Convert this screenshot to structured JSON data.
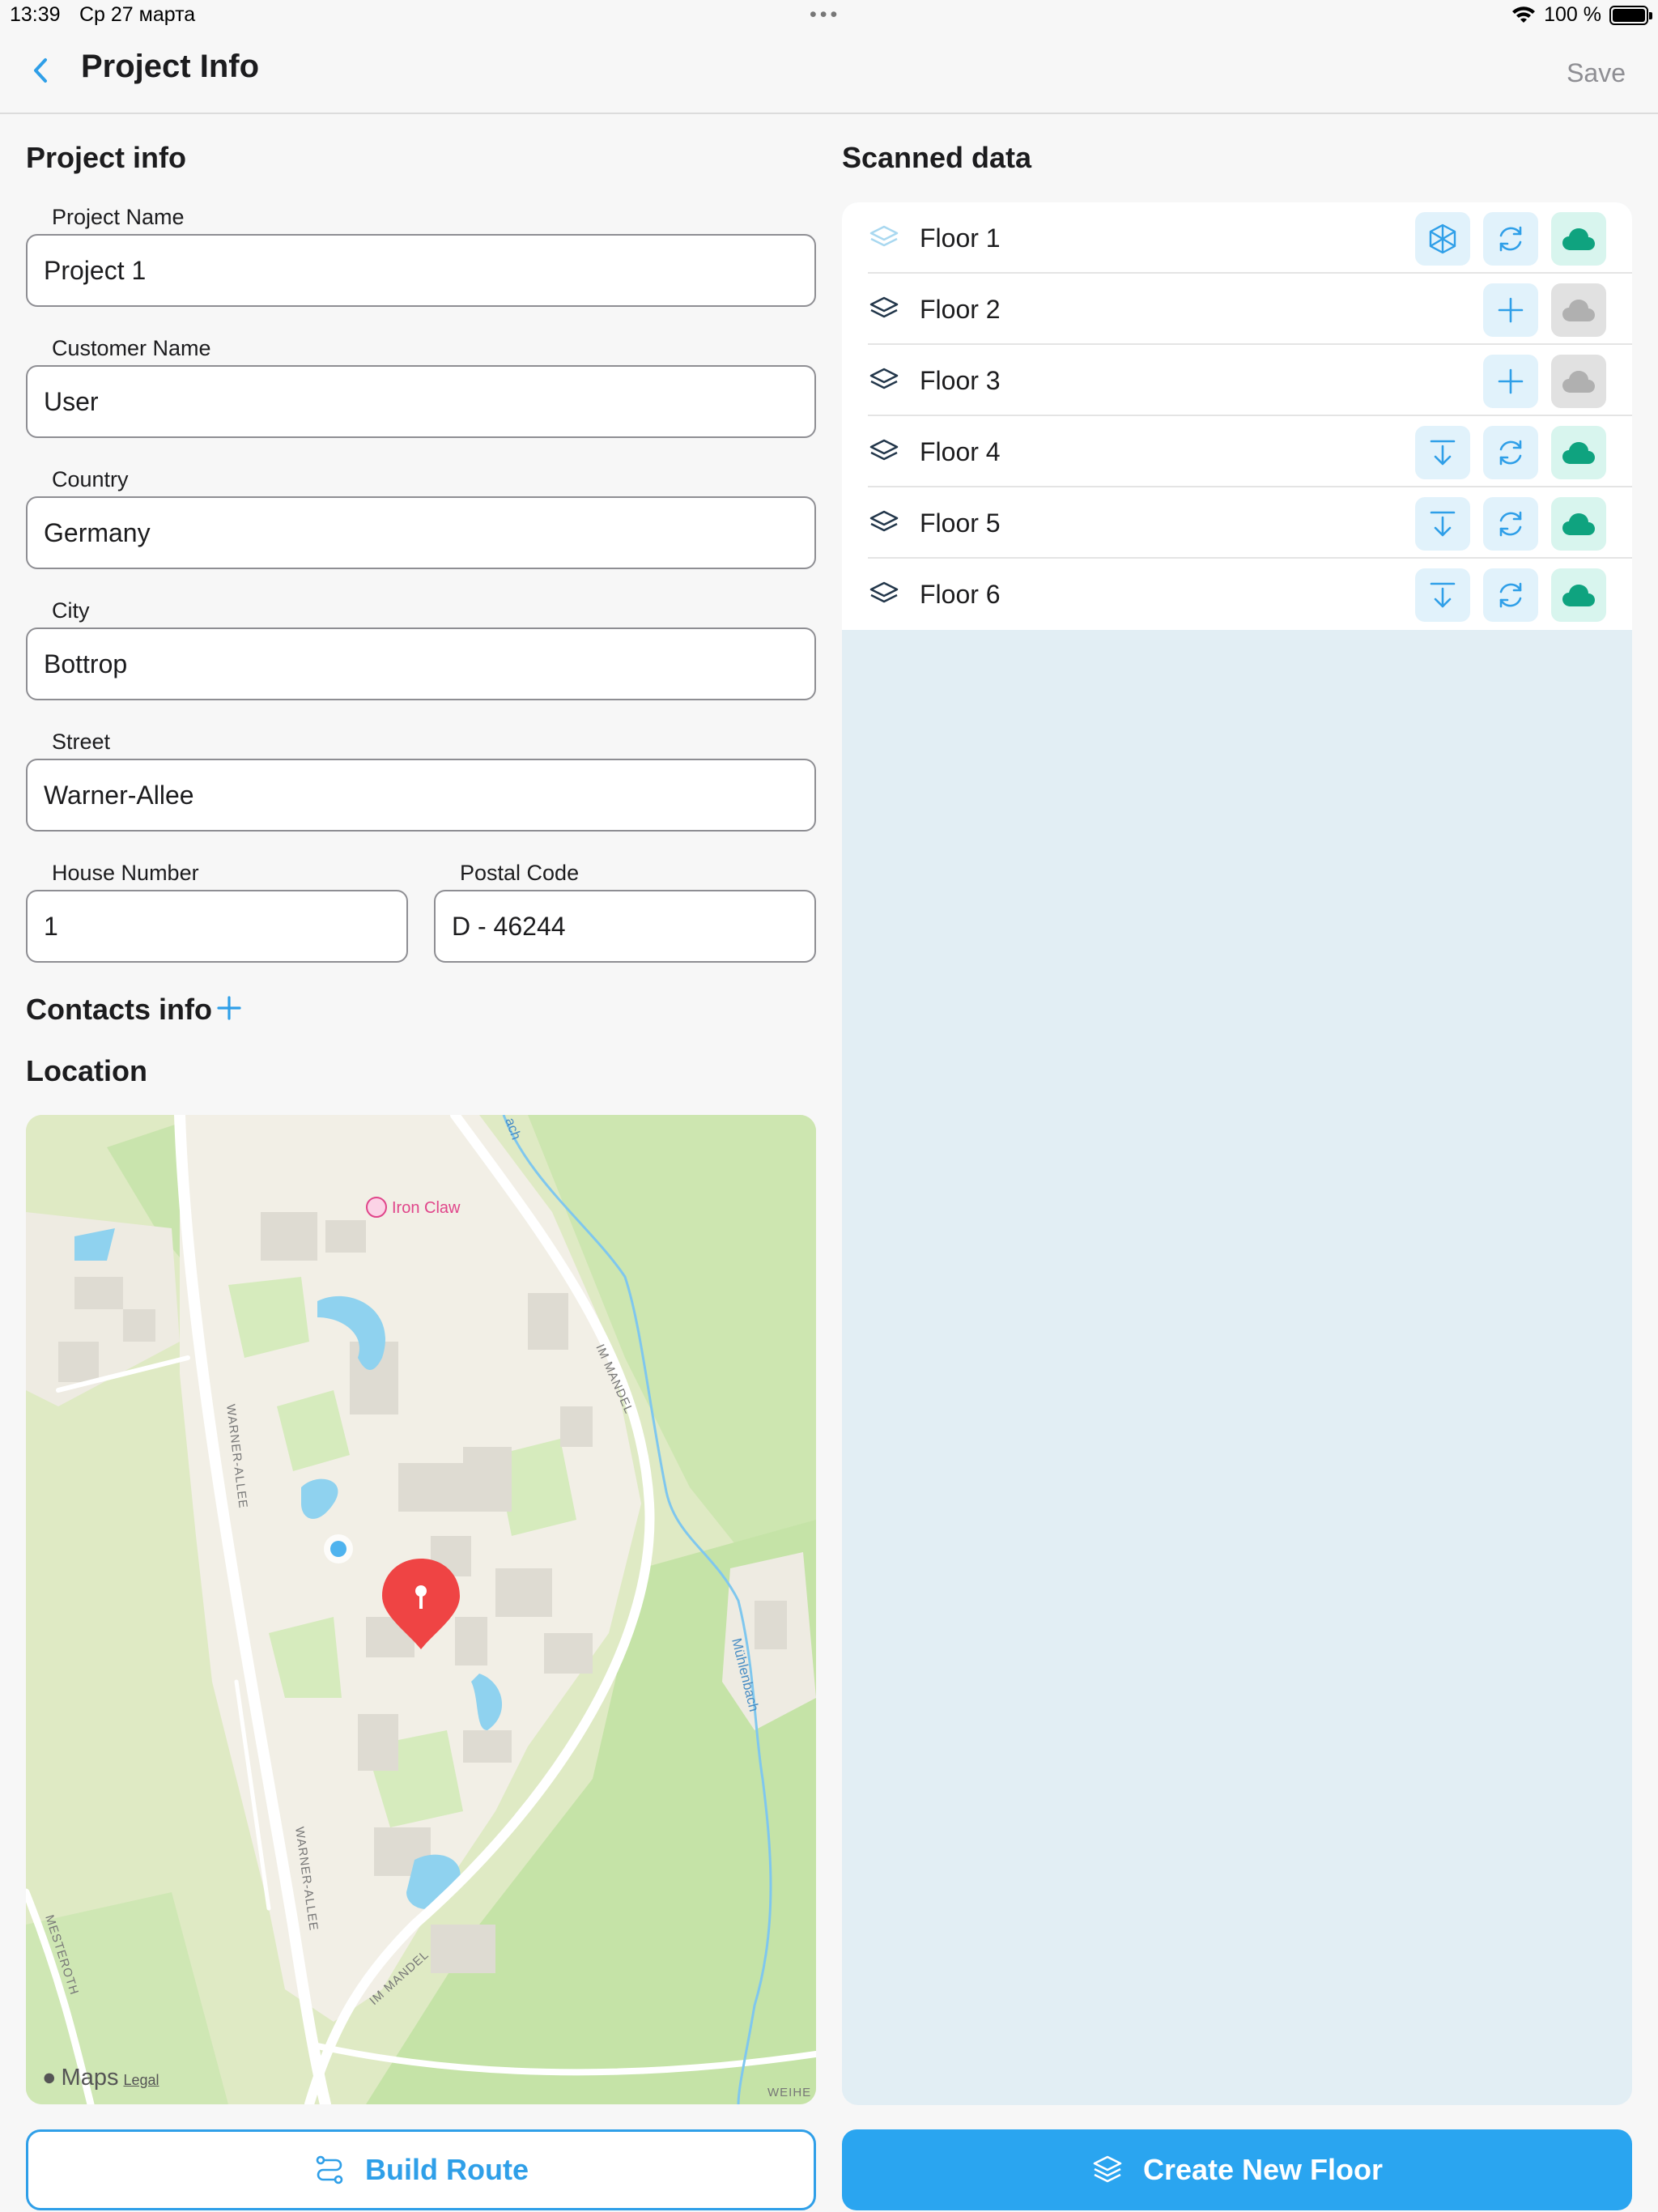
{
  "status_bar": {
    "time": "13:39",
    "date": "Ср 27 марта",
    "dots": "•••",
    "battery": "100 %"
  },
  "nav": {
    "back_icon": "chevron-left-icon",
    "title": "Project Info",
    "save_label": "Save"
  },
  "project_info": {
    "title": "Project info",
    "fields": {
      "project_name": {
        "label": "Project Name",
        "value": "Project 1"
      },
      "customer_name": {
        "label": "Customer Name",
        "value": "User"
      },
      "country": {
        "label": "Country",
        "value": "Germany"
      },
      "city": {
        "label": "City",
        "value": "Bottrop"
      },
      "street": {
        "label": "Street",
        "value": "Warner-Allee"
      },
      "house_number": {
        "label": "House Number",
        "value": "1"
      },
      "postal_code": {
        "label": "Postal Code",
        "value": "D - 46244"
      }
    }
  },
  "contacts": {
    "title": "Contacts info"
  },
  "location": {
    "title": "Location",
    "map": {
      "poi": "Iron Claw",
      "roads": [
        "WARNER-ALLEE",
        "IM MANDEL",
        "MESTEROTH",
        "WEIHE"
      ],
      "river": "Mühlenbach",
      "river_top": "ach",
      "brand": "Maps",
      "legal": "Legal"
    }
  },
  "scanned_data": {
    "title": "Scanned data",
    "floors": [
      {
        "name": "Floor 1",
        "actions": [
          "3d-model-icon",
          "sync-icon",
          "cloud-synced-icon"
        ]
      },
      {
        "name": "Floor 2",
        "actions": [
          "add-icon",
          "cloud-not-synced-icon"
        ]
      },
      {
        "name": "Floor 3",
        "actions": [
          "add-icon",
          "cloud-not-synced-icon"
        ]
      },
      {
        "name": "Floor 4",
        "actions": [
          "download-icon",
          "sync-icon",
          "cloud-synced-icon"
        ]
      },
      {
        "name": "Floor 5",
        "actions": [
          "download-icon",
          "sync-icon",
          "cloud-synced-icon"
        ]
      },
      {
        "name": "Floor 6",
        "actions": [
          "download-icon",
          "sync-icon",
          "cloud-synced-icon"
        ]
      }
    ]
  },
  "buttons": {
    "build_route": "Build Route",
    "create_floor": "Create New Floor"
  },
  "colors": {
    "accent": "#2aa5f0",
    "synced_green": "#0fa37f",
    "not_synced_gray": "#b0b0b0",
    "text_primary": "#1c1c1e",
    "map_pin": "#ef4444"
  }
}
